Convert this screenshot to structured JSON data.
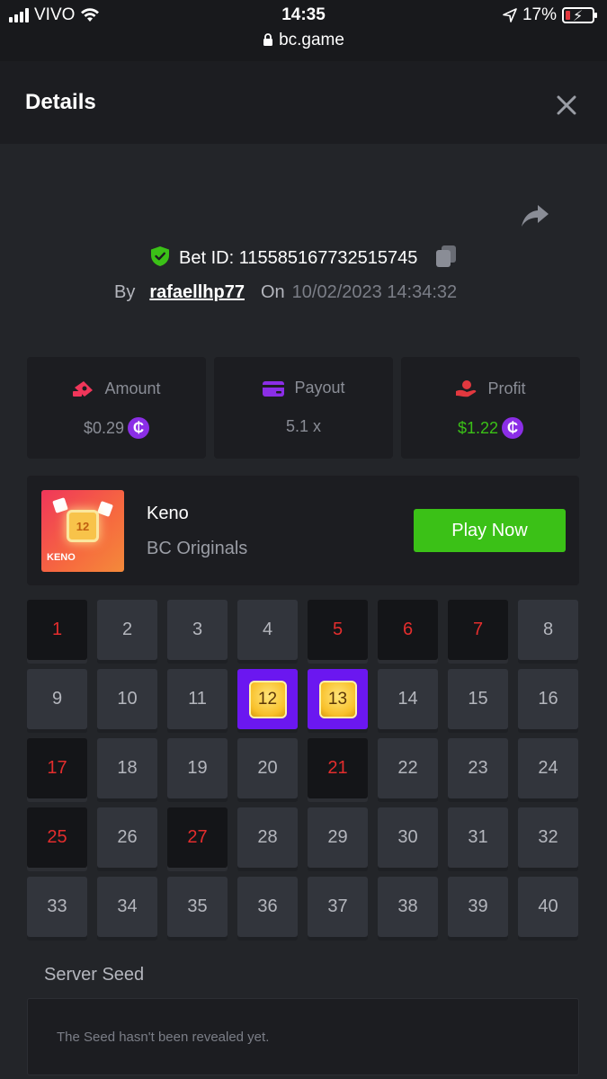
{
  "status_bar": {
    "carrier": "VIVO",
    "time": "14:35",
    "url": "bc.game",
    "battery": "17%"
  },
  "header": {
    "title": "Details"
  },
  "bet": {
    "id_label": "Bet ID: 115585167732515745",
    "by_label": "By",
    "user": "rafaellhp77",
    "on_label": "On",
    "date": "10/02/2023 14:34:32"
  },
  "stats": {
    "amount": {
      "label": "Amount",
      "value": "$0.29"
    },
    "payout": {
      "label": "Payout",
      "value": "5.1 x"
    },
    "profit": {
      "label": "Profit",
      "value": "$1.22"
    }
  },
  "coin_symbol": "₵",
  "game": {
    "name": "Keno",
    "provider": "BC Originals",
    "thumb_label": "KENO",
    "thumb_number": "12",
    "play_label": "Play Now"
  },
  "keno": {
    "numbers": [
      "1",
      "2",
      "3",
      "4",
      "5",
      "6",
      "7",
      "8",
      "9",
      "10",
      "11",
      "12",
      "13",
      "14",
      "15",
      "16",
      "17",
      "18",
      "19",
      "20",
      "21",
      "22",
      "23",
      "24",
      "25",
      "26",
      "27",
      "28",
      "29",
      "30",
      "31",
      "32",
      "33",
      "34",
      "35",
      "36",
      "37",
      "38",
      "39",
      "40"
    ],
    "missed": [
      1,
      5,
      6,
      7,
      17,
      21,
      25,
      27
    ],
    "hits": [
      12,
      13
    ]
  },
  "seed": {
    "title": "Server Seed",
    "message": "The Seed hasn't been revealed yet."
  },
  "colors": {
    "accent_green": "#3bc117",
    "hit_purple": "#6b17f0",
    "miss_red": "#e32d2d",
    "coin_purple": "#8b2ee6"
  }
}
